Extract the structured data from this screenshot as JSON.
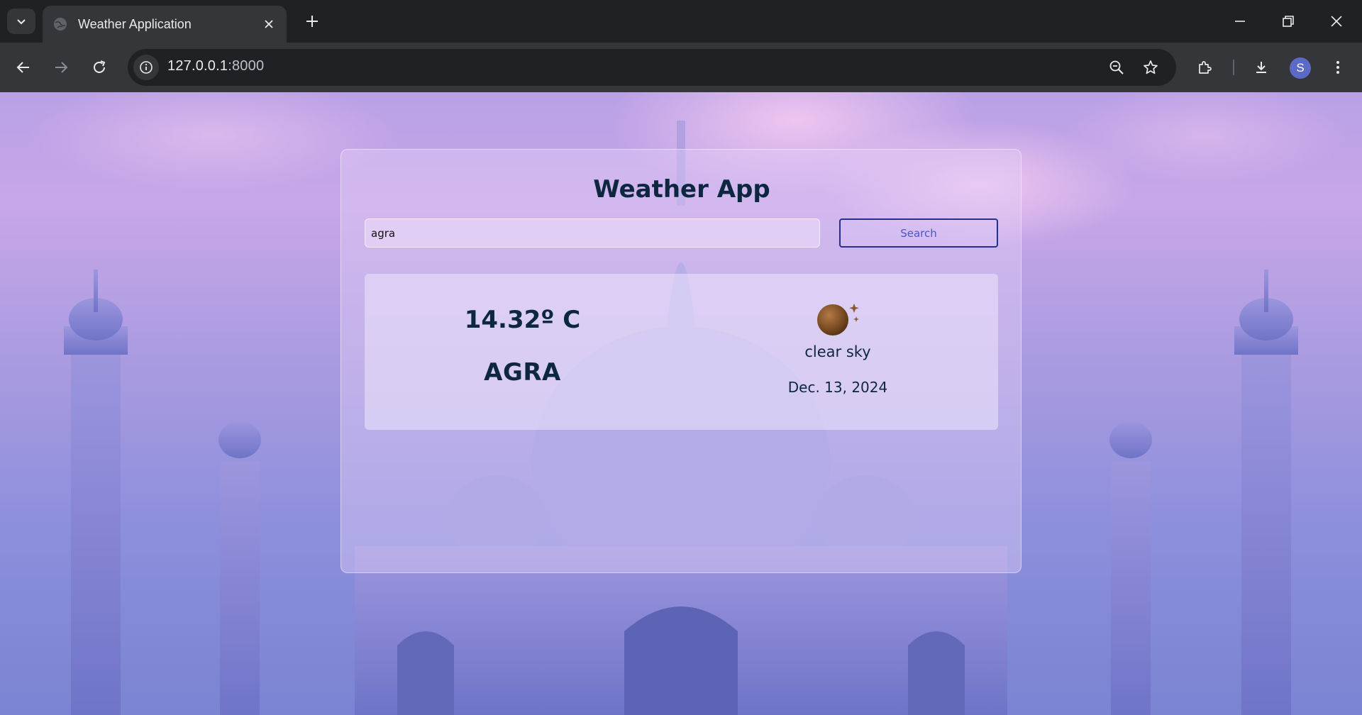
{
  "browser": {
    "tab_title": "Weather Application",
    "url_host": "127.0.0.1",
    "url_port": ":8000",
    "profile_initial": "S"
  },
  "icons": {
    "tab_search": "chevron-down-icon",
    "tab_favicon": "globe-icon",
    "tab_close": "close-icon",
    "new_tab": "plus-icon",
    "minimize": "minimize-icon",
    "restore": "restore-icon",
    "close_window": "close-icon",
    "back": "arrow-left-icon",
    "forward": "arrow-right-icon",
    "reload": "reload-icon",
    "site_info": "info-icon",
    "zoom": "zoom-out-icon",
    "bookmark": "star-icon",
    "extensions": "puzzle-icon",
    "downloads": "download-icon",
    "menu": "kebab-menu-icon",
    "weather": "clear-sky-night-icon"
  },
  "app": {
    "title": "Weather App",
    "search": {
      "value": "agra",
      "placeholder": "",
      "button_label": "Search"
    },
    "result": {
      "temperature": "14.32º C",
      "city": "AGRA",
      "description": "clear sky",
      "date": "Dec. 13, 2024"
    }
  },
  "colors": {
    "text_primary": "#0d2740",
    "button_border": "#24308c",
    "button_text": "#4b56c8",
    "chrome_dark": "#202124",
    "chrome_mid": "#35363a",
    "avatar": "#5b6ac4"
  }
}
